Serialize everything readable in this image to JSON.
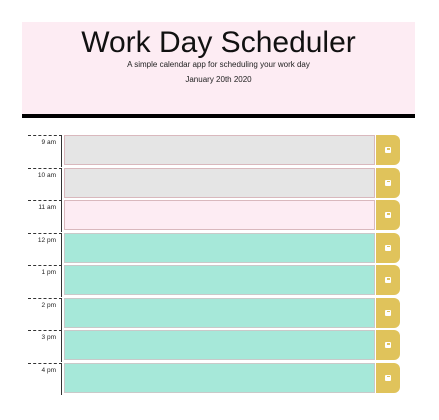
{
  "header": {
    "title": "Work Day Scheduler",
    "subtitle": "A simple calendar app for scheduling your work day",
    "date": "January 20th 2020"
  },
  "colors": {
    "past": "#e5e5e5",
    "present": "#fdecf3",
    "future": "#a6e8d9",
    "save": "#e0c35b",
    "header_bg": "#fdecf3"
  },
  "rows": [
    {
      "hour": "9 am",
      "status": "past",
      "text": "",
      "save_icon": "floppy-disk-icon"
    },
    {
      "hour": "10 am",
      "status": "past",
      "text": "",
      "save_icon": "floppy-disk-icon"
    },
    {
      "hour": "11 am",
      "status": "present",
      "text": "",
      "save_icon": "floppy-disk-icon"
    },
    {
      "hour": "12 pm",
      "status": "future",
      "text": "",
      "save_icon": "floppy-disk-icon"
    },
    {
      "hour": "1 pm",
      "status": "future",
      "text": "",
      "save_icon": "floppy-disk-icon"
    },
    {
      "hour": "2 pm",
      "status": "future",
      "text": "",
      "save_icon": "floppy-disk-icon"
    },
    {
      "hour": "3 pm",
      "status": "future",
      "text": "",
      "save_icon": "floppy-disk-icon"
    },
    {
      "hour": "4 pm",
      "status": "future",
      "text": "",
      "save_icon": "floppy-disk-icon"
    }
  ]
}
